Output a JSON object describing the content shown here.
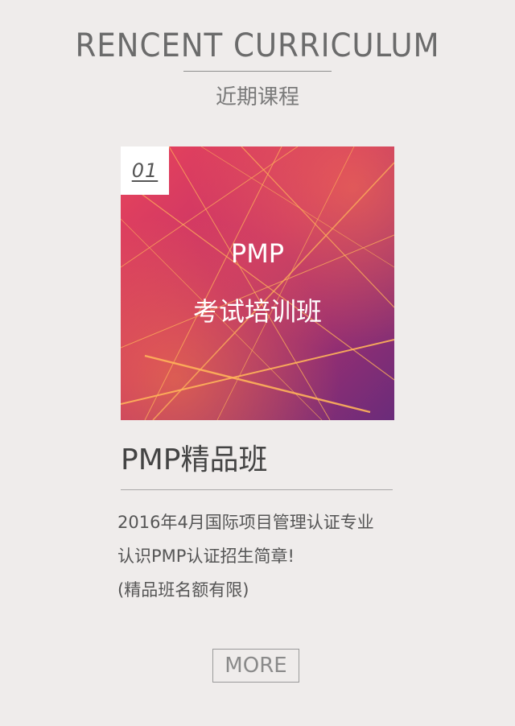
{
  "section": {
    "title_en": "RENCENT CURRICULUM",
    "title_cn": "近期课程"
  },
  "course": {
    "index": "01",
    "card_line1": "PMP",
    "card_line2": "考试培训班",
    "title": "PMP精品班",
    "description_lines": [
      "2016年4月国际项目管理认证专业",
      "认识PMP认证招生简章!",
      "(精品班名额有限)"
    ]
  },
  "more_label": "MORE",
  "colors": {
    "background": "#efeceb",
    "card_gradient_start": "#e8415e",
    "card_gradient_mid": "#b52e6a",
    "card_gradient_end": "#6e2a78",
    "card_lines": "#ffb35a"
  }
}
